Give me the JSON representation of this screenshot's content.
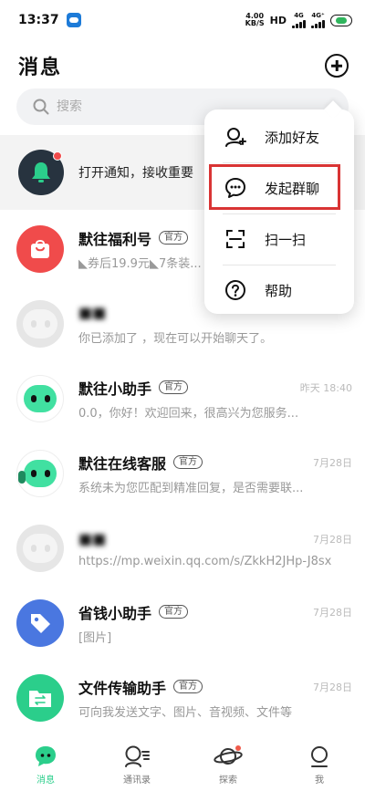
{
  "status_bar": {
    "time": "13:37",
    "net_speed": "4.00",
    "net_unit": "KB/S",
    "hd": "HD",
    "sig1_label": "4G",
    "sig2_label": "4G⁺",
    "battery_color": "#2fb55d"
  },
  "header": {
    "title": "消息"
  },
  "search": {
    "placeholder": "搜索"
  },
  "notification": {
    "text": "打开通知，接收重要"
  },
  "popup_menu": {
    "items": [
      {
        "label": "添加好友",
        "icon": "add-friend-icon"
      },
      {
        "label": "发起群聊",
        "icon": "group-chat-icon"
      },
      {
        "label": "扫一扫",
        "icon": "scan-icon"
      },
      {
        "label": "帮助",
        "icon": "help-icon"
      }
    ],
    "highlight_color": "#d93434"
  },
  "conversations": [
    {
      "name": "默往福利号",
      "tag": "官方",
      "time": "",
      "preview": "◣券后19.9元◣7条装...",
      "avatar": "gift-icon",
      "color": "#f04b4b"
    },
    {
      "name": "",
      "tag": "",
      "time": "",
      "preview": "你已添加了      ，现在可以开始聊天了。",
      "avatar": "default-avatar-icon",
      "color": "#e6e6e6"
    },
    {
      "name": "默往小助手",
      "tag": "官方",
      "time": "昨天 18:40",
      "preview": "0.0，你好！欢迎回来，很高兴为您服务...",
      "avatar": "assistant-icon",
      "color": "#2bce8b"
    },
    {
      "name": "默往在线客服",
      "tag": "官方",
      "time": "7月28日",
      "preview": "系统未为您匹配到精准回复，是否需要联...",
      "avatar": "customer-service-icon",
      "color": "#2bce8b"
    },
    {
      "name": "",
      "tag": "",
      "time": "7月28日",
      "preview": "https://mp.weixin.qq.com/s/ZkkH2JHp-J8sx",
      "avatar": "default-avatar-icon",
      "color": "#e6e6e6"
    },
    {
      "name": "省钱小助手",
      "tag": "官方",
      "time": "7月28日",
      "preview": "[图片]",
      "avatar": "tag-icon",
      "color": "#4a77e0"
    },
    {
      "name": "文件传输助手",
      "tag": "官方",
      "time": "7月28日",
      "preview": "可向我发送文字、图片、音视频、文件等",
      "avatar": "file-transfer-icon",
      "color": "#2bce8b"
    }
  ],
  "bottom_nav": {
    "items": [
      {
        "label": "消息",
        "icon": "messages-icon",
        "active": true
      },
      {
        "label": "通讯录",
        "icon": "contacts-icon",
        "active": false
      },
      {
        "label": "探索",
        "icon": "explore-planet-icon",
        "active": false
      },
      {
        "label": "我",
        "icon": "profile-icon",
        "active": false
      }
    ],
    "active_color": "#2bce8b"
  }
}
